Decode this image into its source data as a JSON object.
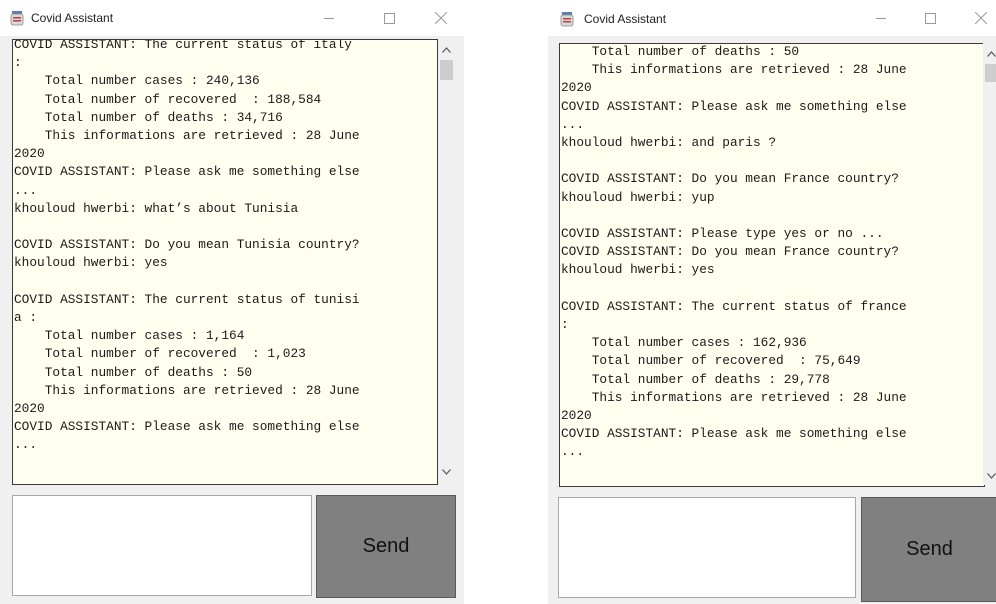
{
  "windows": [
    {
      "title": "Covid Assistant",
      "chat_lines": [
        "COVID ASSISTANT: The current status of italy",
        ":",
        "    Total number cases : 240,136",
        "    Total number of recovered  : 188,584",
        "    Total number of deaths : 34,716",
        "    This informations are retrieved : 28 June",
        "2020",
        "COVID ASSISTANT: Please ask me something else",
        "...",
        "khouloud hwerbi: what’s about Tunisia",
        "",
        "COVID ASSISTANT: Do you mean Tunisia country?",
        "khouloud hwerbi: yes",
        "",
        "COVID ASSISTANT: The current status of tunisi",
        "a :",
        "    Total number cases : 1,164",
        "    Total number of recovered  : 1,023",
        "    Total number of deaths : 50",
        "    This informations are retrieved : 28 June",
        "2020",
        "COVID ASSISTANT: Please ask me something else",
        "..."
      ],
      "input_value": "",
      "send_label": "Send"
    },
    {
      "title": "Covid Assistant",
      "chat_lines": [
        "    Total number of deaths : 50",
        "    This informations are retrieved : 28 June",
        "2020",
        "COVID ASSISTANT: Please ask me something else",
        "...",
        "khouloud hwerbi: and paris ?",
        "",
        "COVID ASSISTANT: Do you mean France country?",
        "khouloud hwerbi: yup",
        "",
        "COVID ASSISTANT: Please type yes or no ...",
        "COVID ASSISTANT: Do you mean France country?",
        "khouloud hwerbi: yes",
        "",
        "COVID ASSISTANT: The current status of france",
        ":",
        "    Total number cases : 162,936",
        "    Total number of recovered  : 75,649",
        "    Total number of deaths : 29,778",
        "    This informations are retrieved : 28 June",
        "2020",
        "COVID ASSISTANT: Please ask me something else",
        "..."
      ],
      "input_value": "",
      "send_label": "Send"
    }
  ],
  "colors": {
    "chat_background": "#fffff0",
    "send_button": "#808080",
    "window_frame": "#f0f0f0"
  }
}
